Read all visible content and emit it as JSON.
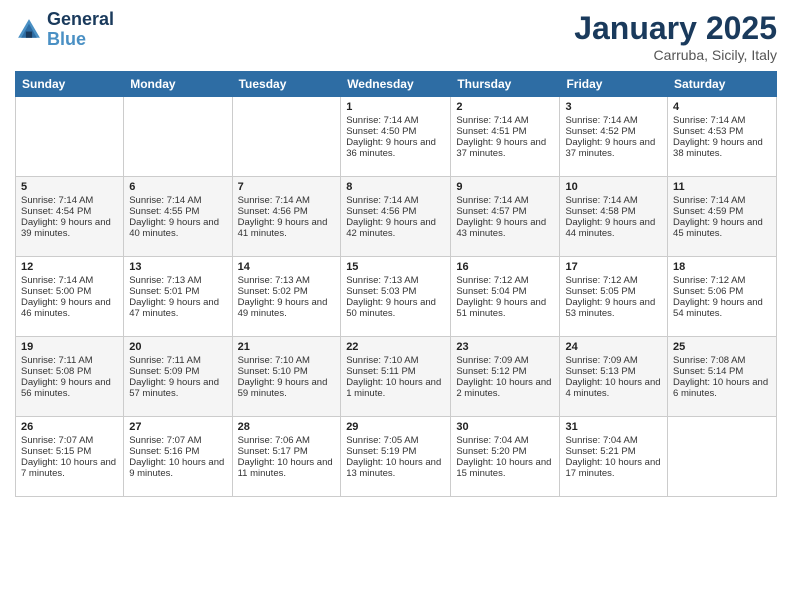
{
  "header": {
    "logo_line1": "General",
    "logo_line2": "Blue",
    "month": "January 2025",
    "location": "Carruba, Sicily, Italy"
  },
  "weekdays": [
    "Sunday",
    "Monday",
    "Tuesday",
    "Wednesday",
    "Thursday",
    "Friday",
    "Saturday"
  ],
  "weeks": [
    [
      {
        "day": "",
        "text": ""
      },
      {
        "day": "",
        "text": ""
      },
      {
        "day": "",
        "text": ""
      },
      {
        "day": "1",
        "text": "Sunrise: 7:14 AM\nSunset: 4:50 PM\nDaylight: 9 hours and 36 minutes."
      },
      {
        "day": "2",
        "text": "Sunrise: 7:14 AM\nSunset: 4:51 PM\nDaylight: 9 hours and 37 minutes."
      },
      {
        "day": "3",
        "text": "Sunrise: 7:14 AM\nSunset: 4:52 PM\nDaylight: 9 hours and 37 minutes."
      },
      {
        "day": "4",
        "text": "Sunrise: 7:14 AM\nSunset: 4:53 PM\nDaylight: 9 hours and 38 minutes."
      }
    ],
    [
      {
        "day": "5",
        "text": "Sunrise: 7:14 AM\nSunset: 4:54 PM\nDaylight: 9 hours and 39 minutes."
      },
      {
        "day": "6",
        "text": "Sunrise: 7:14 AM\nSunset: 4:55 PM\nDaylight: 9 hours and 40 minutes."
      },
      {
        "day": "7",
        "text": "Sunrise: 7:14 AM\nSunset: 4:56 PM\nDaylight: 9 hours and 41 minutes."
      },
      {
        "day": "8",
        "text": "Sunrise: 7:14 AM\nSunset: 4:56 PM\nDaylight: 9 hours and 42 minutes."
      },
      {
        "day": "9",
        "text": "Sunrise: 7:14 AM\nSunset: 4:57 PM\nDaylight: 9 hours and 43 minutes."
      },
      {
        "day": "10",
        "text": "Sunrise: 7:14 AM\nSunset: 4:58 PM\nDaylight: 9 hours and 44 minutes."
      },
      {
        "day": "11",
        "text": "Sunrise: 7:14 AM\nSunset: 4:59 PM\nDaylight: 9 hours and 45 minutes."
      }
    ],
    [
      {
        "day": "12",
        "text": "Sunrise: 7:14 AM\nSunset: 5:00 PM\nDaylight: 9 hours and 46 minutes."
      },
      {
        "day": "13",
        "text": "Sunrise: 7:13 AM\nSunset: 5:01 PM\nDaylight: 9 hours and 47 minutes."
      },
      {
        "day": "14",
        "text": "Sunrise: 7:13 AM\nSunset: 5:02 PM\nDaylight: 9 hours and 49 minutes."
      },
      {
        "day": "15",
        "text": "Sunrise: 7:13 AM\nSunset: 5:03 PM\nDaylight: 9 hours and 50 minutes."
      },
      {
        "day": "16",
        "text": "Sunrise: 7:12 AM\nSunset: 5:04 PM\nDaylight: 9 hours and 51 minutes."
      },
      {
        "day": "17",
        "text": "Sunrise: 7:12 AM\nSunset: 5:05 PM\nDaylight: 9 hours and 53 minutes."
      },
      {
        "day": "18",
        "text": "Sunrise: 7:12 AM\nSunset: 5:06 PM\nDaylight: 9 hours and 54 minutes."
      }
    ],
    [
      {
        "day": "19",
        "text": "Sunrise: 7:11 AM\nSunset: 5:08 PM\nDaylight: 9 hours and 56 minutes."
      },
      {
        "day": "20",
        "text": "Sunrise: 7:11 AM\nSunset: 5:09 PM\nDaylight: 9 hours and 57 minutes."
      },
      {
        "day": "21",
        "text": "Sunrise: 7:10 AM\nSunset: 5:10 PM\nDaylight: 9 hours and 59 minutes."
      },
      {
        "day": "22",
        "text": "Sunrise: 7:10 AM\nSunset: 5:11 PM\nDaylight: 10 hours and 1 minute."
      },
      {
        "day": "23",
        "text": "Sunrise: 7:09 AM\nSunset: 5:12 PM\nDaylight: 10 hours and 2 minutes."
      },
      {
        "day": "24",
        "text": "Sunrise: 7:09 AM\nSunset: 5:13 PM\nDaylight: 10 hours and 4 minutes."
      },
      {
        "day": "25",
        "text": "Sunrise: 7:08 AM\nSunset: 5:14 PM\nDaylight: 10 hours and 6 minutes."
      }
    ],
    [
      {
        "day": "26",
        "text": "Sunrise: 7:07 AM\nSunset: 5:15 PM\nDaylight: 10 hours and 7 minutes."
      },
      {
        "day": "27",
        "text": "Sunrise: 7:07 AM\nSunset: 5:16 PM\nDaylight: 10 hours and 9 minutes."
      },
      {
        "day": "28",
        "text": "Sunrise: 7:06 AM\nSunset: 5:17 PM\nDaylight: 10 hours and 11 minutes."
      },
      {
        "day": "29",
        "text": "Sunrise: 7:05 AM\nSunset: 5:19 PM\nDaylight: 10 hours and 13 minutes."
      },
      {
        "day": "30",
        "text": "Sunrise: 7:04 AM\nSunset: 5:20 PM\nDaylight: 10 hours and 15 minutes."
      },
      {
        "day": "31",
        "text": "Sunrise: 7:04 AM\nSunset: 5:21 PM\nDaylight: 10 hours and 17 minutes."
      },
      {
        "day": "",
        "text": ""
      }
    ]
  ]
}
